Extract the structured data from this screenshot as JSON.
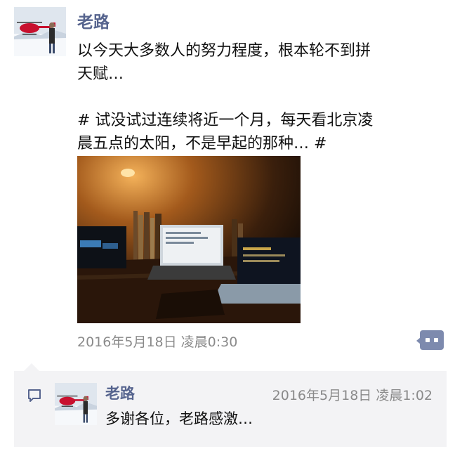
{
  "post": {
    "author": "老路",
    "text_lines": [
      "以今天大多数人的努力程度，根本轮不到拼",
      "天赋…",
      "# 试没试过连续将近一个月，每天看北京凌",
      "晨五点的太阳，不是早起的那种… #"
    ],
    "timestamp": "2016年5月18日 凌晨0:30"
  },
  "reply": {
    "author": "老路",
    "timestamp": "2016年5月18日 凌晨1:02",
    "text": "多谢各位，老路感激…"
  },
  "colors": {
    "name_link": "#56648e",
    "meta_gray": "#8a8a8a",
    "reply_bg": "#f3f3f5",
    "comment_button": "#7d8aae"
  },
  "icons": {
    "comment_button": "comment-more-icon",
    "reply_marker": "speech-bubble-icon"
  }
}
